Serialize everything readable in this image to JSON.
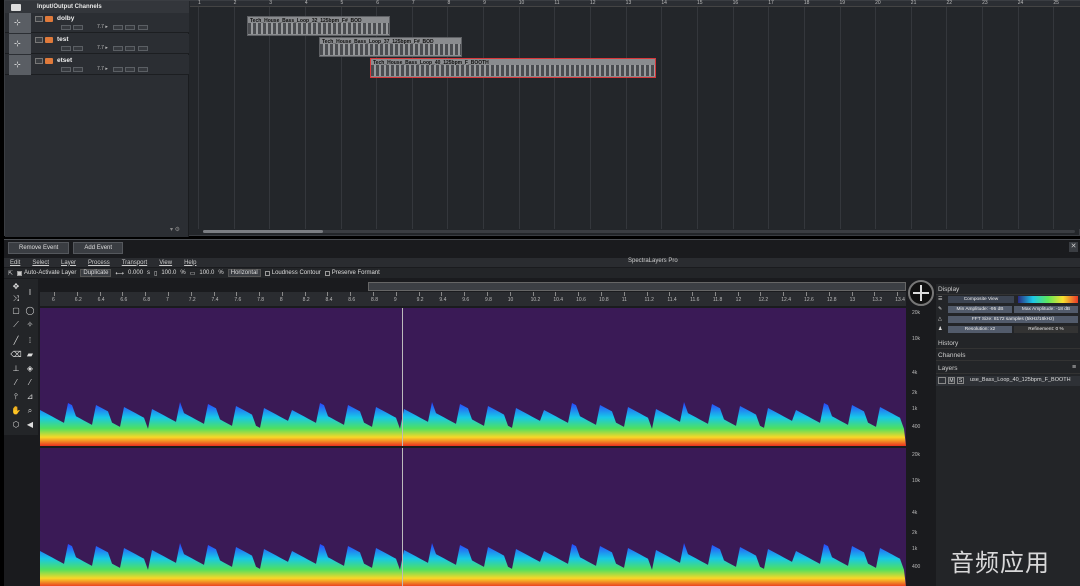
{
  "daw": {
    "folder_label": "Input/Output Channels",
    "tracks": [
      {
        "name": "dolby",
        "vol": "7.7 ▸"
      },
      {
        "name": "test",
        "vol": "7.7 ▸"
      },
      {
        "name": "etset",
        "vol": "7.7 ▸"
      }
    ],
    "bars": [
      "1",
      "2",
      "3",
      "4",
      "5",
      "6",
      "7",
      "8",
      "9",
      "10",
      "11",
      "12",
      "13",
      "14",
      "15",
      "16",
      "17",
      "18",
      "19",
      "20",
      "21",
      "22",
      "23",
      "24",
      "25"
    ],
    "clips": [
      {
        "title": "Tech_House_Bass_Loop_32_125bpm_F#_BOD"
      },
      {
        "title": "Tech_House_Bass_Loop_37_125bpm_F#_BOD"
      },
      {
        "title": "Tech_House_Bass_Loop_40_125bpm_F_BOOTH"
      }
    ]
  },
  "spectralayers": {
    "remove_event": "Remove Event",
    "add_event": "Add Event",
    "close": "✕",
    "menus": [
      "Edit",
      "Select",
      "Layer",
      "Process",
      "Transport",
      "View",
      "Help"
    ],
    "app_title": "SpectraLayers Pro",
    "tool_options": {
      "auto_activate": "Auto-Activate Layer",
      "mode": "Duplicate",
      "offset": "0.000",
      "s_label": "s",
      "pct1": "100.0",
      "pct2": "100.0",
      "pct_sign": "%",
      "direction": "Horizontal",
      "loudness": "Loudness Contour",
      "preserve": "Preserve Formant"
    },
    "time_ticks": [
      "6",
      "6.2",
      "6.4",
      "6.6",
      "6.8",
      "7",
      "7.2",
      "7.4",
      "7.6",
      "7.8",
      "8",
      "8.2",
      "8.4",
      "8.6",
      "8.8",
      "9",
      "9.2",
      "9.4",
      "9.6",
      "9.8",
      "10",
      "10.2",
      "10.4",
      "10.6",
      "10.8",
      "11",
      "11.2",
      "11.4",
      "11.6",
      "11.8",
      "12",
      "12.2",
      "12.4",
      "12.6",
      "12.8",
      "13",
      "13.2",
      "13.4"
    ],
    "freq_labels": [
      "20k",
      "10k",
      "4k",
      "2k",
      "1k",
      "400"
    ],
    "freq_unit": "Hz",
    "panels": {
      "display": "Display",
      "composite": "Composite View",
      "min_amp": "Min Amplitude: -95 dB",
      "max_amp": "Max Amplitude: -18 dB",
      "fft": "FFT Size: 8172 samples (5kHz/16kHz)",
      "resolution": "Resolution: x2",
      "refinement": "Refinement: 0 %",
      "history": "History",
      "channels": "Channels",
      "layers": "Layers",
      "layer_name": "use_Bass_Loop_40_125bpm_F_BOOTH"
    }
  },
  "watermark": "音频应用",
  "colors": {
    "record": "#e07a3b",
    "selected_clip": "#d8373a",
    "spectro_bg": "#3a1a56"
  }
}
